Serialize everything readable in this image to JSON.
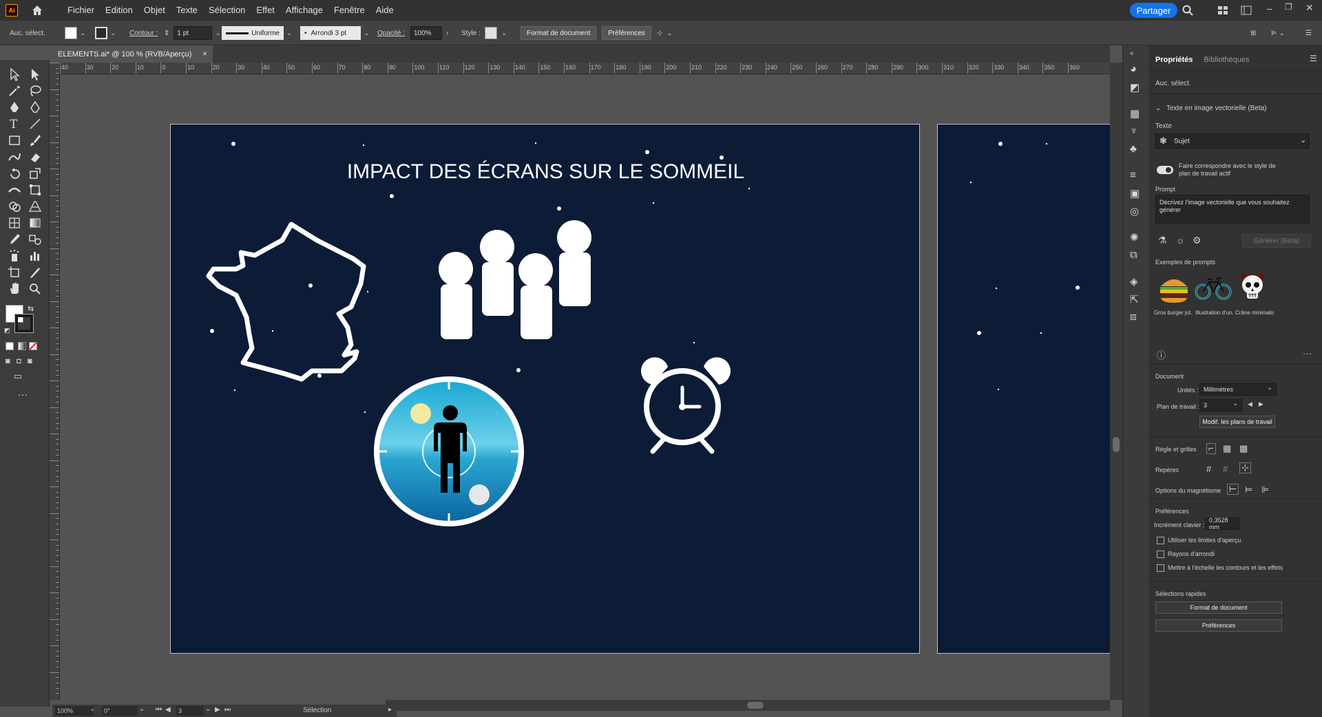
{
  "menubar": {
    "items": [
      "Fichier",
      "Edition",
      "Objet",
      "Texte",
      "Sélection",
      "Effet",
      "Affichage",
      "Fenêtre",
      "Aide"
    ],
    "share_label": "Partager"
  },
  "controlbar": {
    "selection_label": "Auc. sélect.",
    "stroke_label": "Contour :",
    "stroke_value": "1 pt",
    "profile_value": "Uniforme",
    "brush_value": "Arrondi 3 pt",
    "opacity_label": "Opacité :",
    "opacity_value": "100%",
    "style_label": "Style :",
    "doc_format_btn": "Format de document",
    "prefs_btn": "Préférences"
  },
  "document": {
    "tab_title": "ELEMENTS.ai* @ 100 % (RVB/Aperçu)"
  },
  "ruler": {
    "h_ticks": [
      "40",
      "30",
      "20",
      "10",
      "0",
      "10",
      "20",
      "30",
      "40",
      "50",
      "60",
      "70",
      "80",
      "90",
      "100",
      "110",
      "120",
      "130",
      "140",
      "150",
      "160",
      "170",
      "180",
      "190",
      "200",
      "210",
      "220",
      "230",
      "240",
      "250",
      "260",
      "270",
      "280",
      "290",
      "300",
      "310",
      "320",
      "330",
      "340",
      "350",
      "360"
    ]
  },
  "artboard": {
    "title": "IMPACT DES ÉCRANS SUR LE SOMMEIL",
    "background": "#0c1b36"
  },
  "statusbar": {
    "zoom": "100%",
    "rotation": "0°",
    "artboard_num": "3",
    "mode": "Sélection"
  },
  "panel": {
    "tabs": [
      "Propriétés",
      "Bibliothèques"
    ],
    "no_selection": "Auc. sélect.",
    "section_title": "Texte en image vectorielle (Beta)",
    "text_label": "Texte",
    "subject_value": "Sujet",
    "match_style_label": "Faire correspondre avec le style de plan de travail actif",
    "prompt_label": "Prompt",
    "prompt_placeholder": "Décrivez l'image vectorielle que vous souhaitez générer",
    "generate_btn": "Générer (Beta)",
    "examples_label": "Exemples de prompts",
    "examples": [
      "Gros burger jut...",
      "Illustration d'un...",
      "Crâne minimalis..."
    ],
    "document_label": "Document",
    "units_label": "Unités :",
    "units_value": "Millimètres",
    "artboard_label": "Plan de travail :",
    "artboard_value": "3",
    "edit_artboards_btn": "Modif. les plans de travail",
    "rulers_grids_label": "Règle et grilles",
    "guides_label": "Repères",
    "snap_label": "Options du magnétisme",
    "prefs_label": "Préférences",
    "key_increment_label": "Incrément clavier :",
    "key_increment_value": "0,3528 mm",
    "chk_preview_bounds": "Utiliser les limites d'aperçu",
    "chk_corner_radius": "Rayons d'arrondi",
    "chk_scale_strokes": "Mettre à l'échelle les contours et les effets",
    "quick_select_label": "Sélections rapides",
    "quick_doc_format_btn": "Format de document",
    "quick_prefs_btn": "Préférences"
  }
}
